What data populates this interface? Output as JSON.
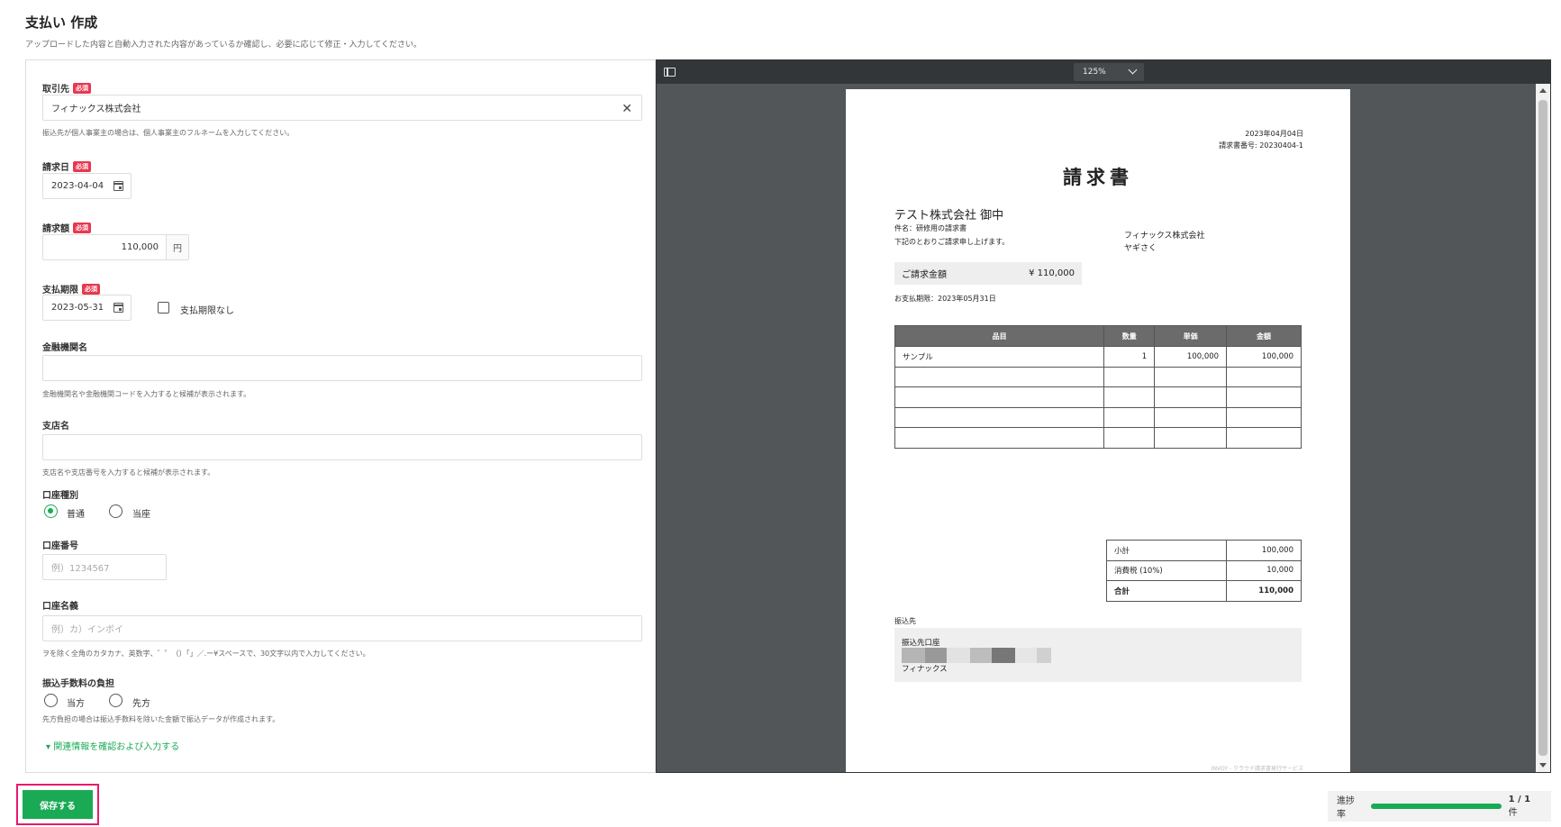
{
  "page": {
    "title": "支払い 作成",
    "description": "アップロードした内容と自動入力された内容があっているか確認し、必要に応じて修正・入力してください。"
  },
  "form": {
    "required_badge": "必須",
    "vendor": {
      "label": "取引先",
      "value": "フィナックス株式会社",
      "hint": "振込先が個人事業主の場合は、個人事業主のフルネームを入力してください。"
    },
    "invoice_date": {
      "label": "請求日",
      "value": "2023-04-04"
    },
    "amount": {
      "label": "請求額",
      "value": "110,000",
      "unit": "円"
    },
    "due_date": {
      "label": "支払期限",
      "value": "2023-05-31",
      "no_due_label": "支払期限なし",
      "no_due_checked": false
    },
    "bank_name": {
      "label": "金融機関名",
      "value": "",
      "hint": "金融機関名や金融機関コードを入力すると候補が表示されます。"
    },
    "branch_name": {
      "label": "支店名",
      "value": "",
      "hint": "支店名や支店番号を入力すると候補が表示されます。"
    },
    "account_type": {
      "label": "口座種別",
      "options": [
        "普通",
        "当座"
      ],
      "selected": "普通"
    },
    "account_number": {
      "label": "口座番号",
      "placeholder": "例）1234567"
    },
    "account_holder": {
      "label": "口座名義",
      "placeholder": "例）カ）インボイ",
      "hint": "ヲを除く全角のカタカナ、英数字、゛゜（）「」／.ー¥スペースで、30文字以内で入力してください。"
    },
    "fee_bearer": {
      "label": "振込手数料の負担",
      "options": [
        "当方",
        "先方"
      ],
      "selected": "",
      "hint": "先方負担の場合は振込手数料を除いた金額で振込データが作成されます。"
    },
    "related_link": "▾ 関連情報を確認および入力する"
  },
  "footer": {
    "save_label": "保存する",
    "progress_label": "進捗率",
    "progress_fraction": 1.0,
    "progress_count": "1 / 1",
    "progress_unit": "件"
  },
  "viewer": {
    "zoom": "125%",
    "invoice": {
      "date": "2023年04月04日",
      "number": "請求書番号: 20230404-1",
      "title": "請求書",
      "recipient": "テスト株式会社 御中",
      "subject": "件名：研修用の請求書",
      "note": "下記のとおりご請求申し上げます。",
      "issuer": "フィナックス株式会社",
      "person": "ヤギさく",
      "total_label": "ご請求金額",
      "total_value": "¥ 110,000",
      "due": "お支払期限：2023年05月31日",
      "columns": [
        "品目",
        "数量",
        "単価",
        "金額"
      ],
      "rows": [
        [
          "サンプル",
          "1",
          "100,000",
          "100,000"
        ],
        [
          "",
          "",
          "",
          ""
        ],
        [
          "",
          "",
          "",
          ""
        ],
        [
          "",
          "",
          "",
          ""
        ],
        [
          "",
          "",
          "",
          ""
        ]
      ],
      "subtotal_label": "小計",
      "subtotal": "100,000",
      "tax_label": "消費税 (10%)",
      "tax": "10,000",
      "grand_label": "合計",
      "grand": "110,000",
      "bank_section": "振込先",
      "bank_title": "振込先口座",
      "bank_holder": "フィナックス",
      "footer_text": "INVOY - クラウド請求書発行サービス"
    }
  },
  "colors": {
    "accent": "#1aaa55",
    "required": "#e8384f",
    "highlight_border": "#e8196c",
    "viewer_bg": "#525659",
    "viewer_toolbar": "#323639"
  }
}
